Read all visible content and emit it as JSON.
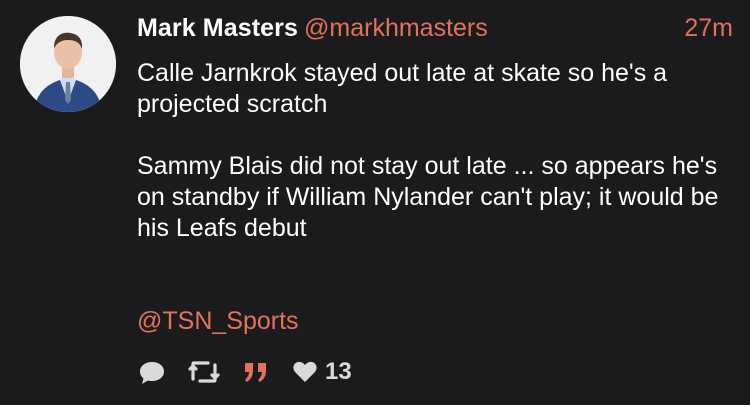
{
  "tweet": {
    "author_name": "Mark Masters",
    "author_handle": "@markhmasters",
    "timestamp": "27m",
    "paragraph_1": "Calle Jarnkrok stayed out late at skate so he's a projected scratch",
    "paragraph_2": "Sammy Blais did not stay out late ... so appears he's on standby if William Nylander can't play; it would be his Leafs debut",
    "mention": "@TSN_Sports",
    "like_count": "13"
  },
  "colors": {
    "background": "#1b1b1d",
    "accent": "#e2725b",
    "text": "#ffffff",
    "icon": "#d9d9d9"
  },
  "icons": [
    "avatar",
    "reply-icon",
    "retweet-icon",
    "quote-icon",
    "heart-icon"
  ]
}
